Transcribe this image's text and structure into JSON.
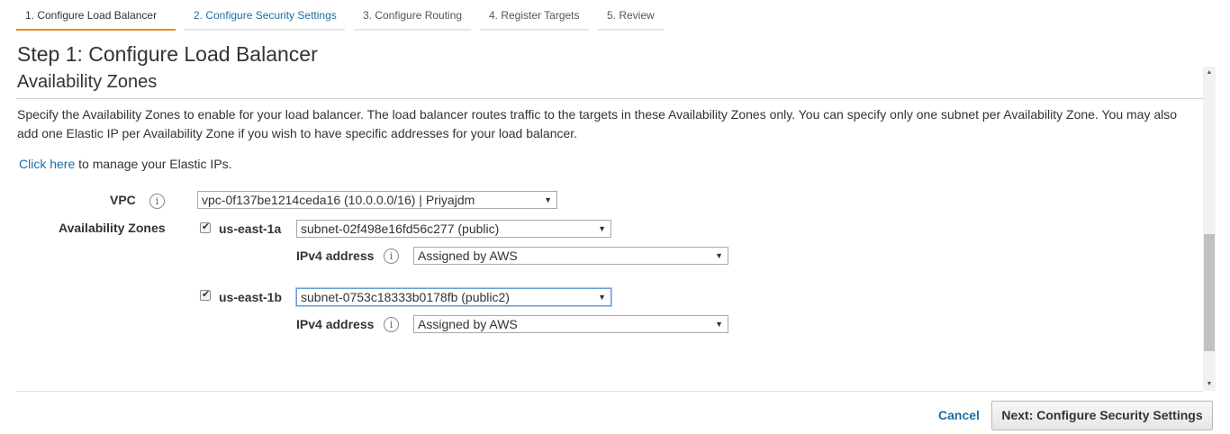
{
  "wizard": {
    "tabs": [
      {
        "label": "1. Configure Load Balancer"
      },
      {
        "label": "2. Configure Security Settings"
      },
      {
        "label": "3. Configure Routing"
      },
      {
        "label": "4. Register Targets"
      },
      {
        "label": "5. Review"
      }
    ]
  },
  "page": {
    "step_title": "Step 1: Configure Load Balancer",
    "section_title": "Availability Zones",
    "description": "Specify the Availability Zones to enable for your load balancer. The load balancer routes traffic to the targets in these Availability Zones only. You can specify only one subnet per Availability Zone. You may also add one Elastic IP per Availability Zone if you wish to have specific addresses for your load balancer.",
    "elastic_link": "Click here",
    "elastic_text": " to manage your Elastic IPs."
  },
  "form": {
    "vpc_label": "VPC",
    "vpc_value": "vpc-0f137be1214ceda16 (10.0.0.0/16) | Priyajdm",
    "az_label": "Availability Zones",
    "info_glyph": "i",
    "caret": "▼",
    "zones": [
      {
        "name": "us-east-1a",
        "subnet": "subnet-02f498e16fd56c277 (public)",
        "ipv4_label": "IPv4 address",
        "ipv4_value": "Assigned by AWS"
      },
      {
        "name": "us-east-1b",
        "subnet": "subnet-0753c18333b0178fb (public2)",
        "ipv4_label": "IPv4 address",
        "ipv4_value": "Assigned by AWS"
      }
    ]
  },
  "footer": {
    "cancel_label": "Cancel",
    "next_label": "Next: Configure Security Settings"
  },
  "scrollbar": {
    "up": "▲",
    "down": "▼"
  },
  "colors": {
    "accent_tab": "#e88c1a",
    "link": "#1d6fa5"
  }
}
